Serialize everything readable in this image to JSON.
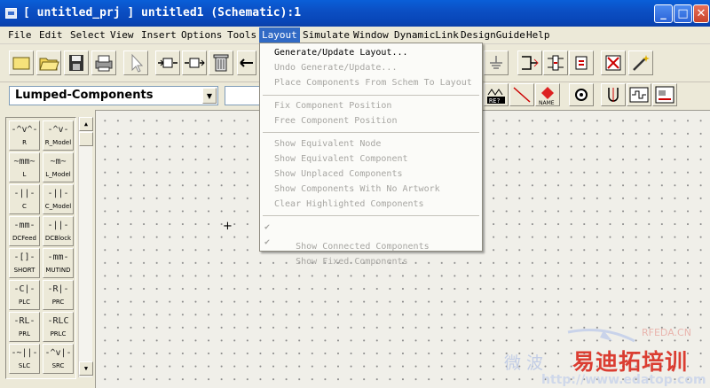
{
  "window": {
    "title": "[ untitled_prj ] untitled1 (Schematic):1"
  },
  "window_buttons": {
    "minimize": "_",
    "maximize": "□",
    "close": "✕"
  },
  "menubar": [
    {
      "label": "File"
    },
    {
      "label": "Edit"
    },
    {
      "label": "Select"
    },
    {
      "label": "View"
    },
    {
      "label": "Insert"
    },
    {
      "label": "Options"
    },
    {
      "label": "Tools"
    },
    {
      "label": "Layout"
    },
    {
      "label": "Simulate"
    },
    {
      "label": "Window"
    },
    {
      "label": "DynamicLink"
    },
    {
      "label": "DesignGuide"
    },
    {
      "label": "Help"
    }
  ],
  "toolbar_icons": [
    "new-icon",
    "open-icon",
    "save-icon",
    "print-icon",
    "select-arrow-icon",
    "insert-component-icon",
    "insert-pin-icon",
    "delete-icon",
    "move-icon",
    "ground-icon",
    "var-icon",
    "wire-icon",
    "name-icon",
    "tune-icon",
    "port-icon",
    "plot-icon",
    "text-icon"
  ],
  "palette": {
    "selected": "Lumped-Components",
    "items": [
      {
        "label": "R",
        "symbol": "-^v^-"
      },
      {
        "label": "R_Model",
        "symbol": "-^v-"
      },
      {
        "label": "L",
        "symbol": "~mm~"
      },
      {
        "label": "L_Model",
        "symbol": "~m~"
      },
      {
        "label": "C",
        "symbol": "-||-"
      },
      {
        "label": "C_Model",
        "symbol": "-||-"
      },
      {
        "label": "DCFeed",
        "symbol": "-mm-"
      },
      {
        "label": "DCBlock",
        "symbol": "-||-"
      },
      {
        "label": "SHORT",
        "symbol": "-[]-"
      },
      {
        "label": "MUTIND",
        "symbol": "-mm-"
      },
      {
        "label": "PLC",
        "symbol": "-C|-"
      },
      {
        "label": "PRC",
        "symbol": "-R|-"
      },
      {
        "label": "PRL",
        "symbol": "-RL-"
      },
      {
        "label": "PRLC",
        "symbol": "-RLC"
      },
      {
        "label": "SLC",
        "symbol": "-~||-"
      },
      {
        "label": "SRC",
        "symbol": "-^v|-"
      }
    ]
  },
  "layout_menu": {
    "items": [
      {
        "label": "Generate/Update Layout...",
        "enabled": true,
        "checked": false
      },
      {
        "label": "Undo Generate/Update...",
        "enabled": false,
        "checked": false
      },
      {
        "label": "Place Components From Schem To Layout",
        "enabled": false,
        "checked": false
      },
      {
        "label": "Fix Component Position",
        "enabled": false,
        "checked": false
      },
      {
        "label": "Free Component Position",
        "enabled": false,
        "checked": false
      },
      {
        "label": "Show Equivalent Node",
        "enabled": false,
        "checked": false
      },
      {
        "label": "Show Equivalent Component",
        "enabled": false,
        "checked": false
      },
      {
        "label": "Show Unplaced Components",
        "enabled": false,
        "checked": false
      },
      {
        "label": "Show Components With No Artwork",
        "enabled": false,
        "checked": false
      },
      {
        "label": "Clear Highlighted Components",
        "enabled": false,
        "checked": false
      },
      {
        "label": "Show Connected Components",
        "enabled": false,
        "checked": true
      },
      {
        "label": "Show Fixed Components",
        "enabled": false,
        "checked": true
      }
    ],
    "check_glyph": "✔"
  },
  "canvas": {
    "cursor": "+"
  },
  "watermark": {
    "brand_cn": "易迪拓培训",
    "url": "http://www.edatop.com",
    "rf": "RFEDA.CN",
    "weibo": "微 波"
  }
}
